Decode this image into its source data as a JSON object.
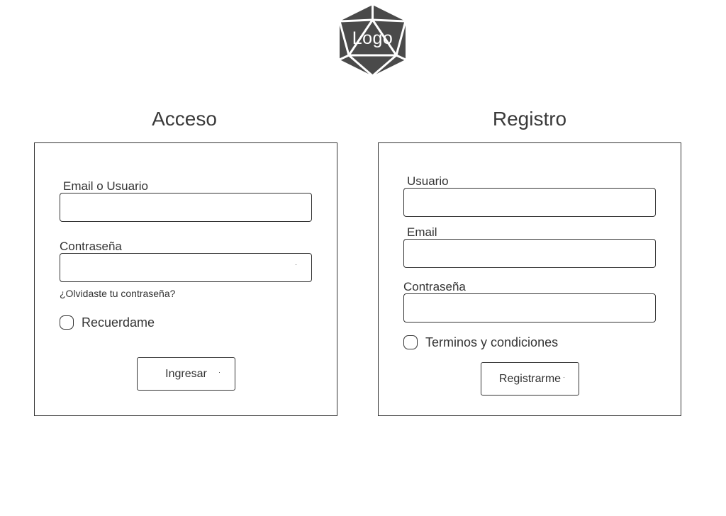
{
  "logo": {
    "text": "Logo",
    "icon": "d20-die-icon"
  },
  "login": {
    "title": "Acceso",
    "email_label": "Email o Usuario",
    "email_value": "",
    "password_label": "Contraseña",
    "password_value": "",
    "forgot_link": "¿Olvidaste tu contraseña?",
    "remember_label": "Recuerdame",
    "remember_checked": false,
    "submit_label": "Ingresar"
  },
  "register": {
    "title": "Registro",
    "user_label": "Usuario",
    "user_value": "",
    "email_label": "Email",
    "email_value": "",
    "password_label": "Contraseña",
    "password_value": "",
    "terms_label": "Terminos y condiciones",
    "terms_checked": false,
    "submit_label": "Registrarme"
  },
  "colors": {
    "logo_fill": "#4a4a4a",
    "text": "#333333",
    "border": "#333333",
    "background": "#ffffff"
  }
}
